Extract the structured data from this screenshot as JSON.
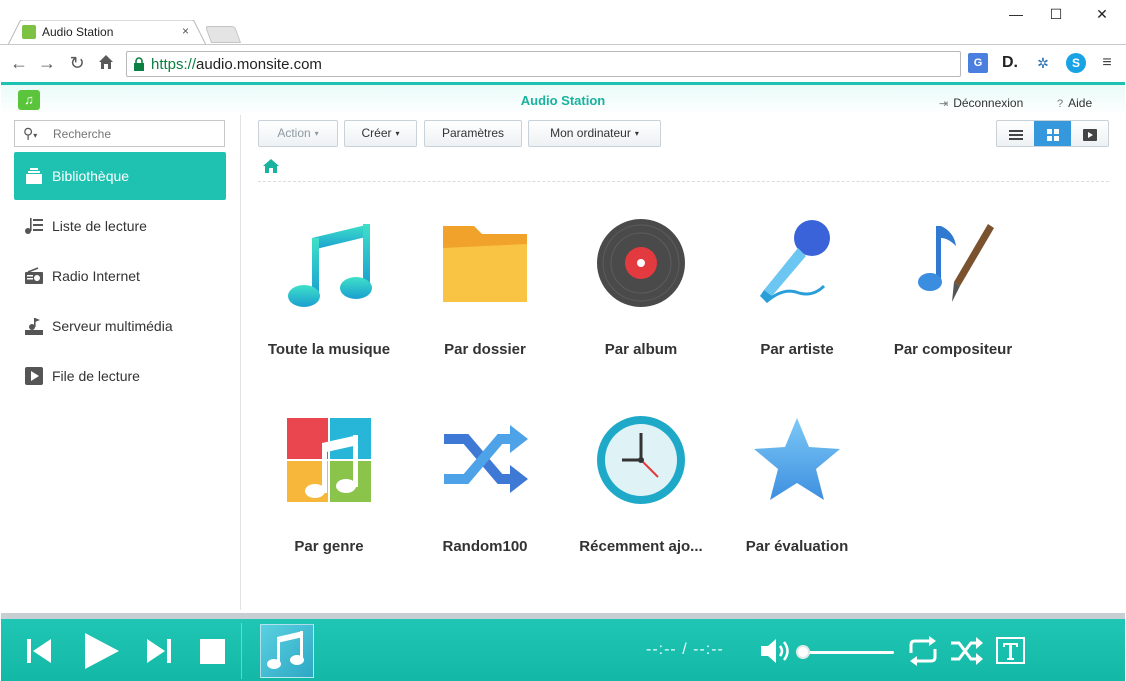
{
  "browser": {
    "tab_title": "Audio Station",
    "tab_close": "×",
    "url_scheme": "https://",
    "url_host": "audio.monsite.com",
    "window_controls": {
      "minimize": "—",
      "maximize": "☐",
      "close": "✕"
    }
  },
  "app": {
    "title": "Audio Station",
    "logout_label": "Déconnexion",
    "help_label": "Aide"
  },
  "sidebar": {
    "search_placeholder": "Recherche",
    "items": [
      {
        "label": "Bibliothèque",
        "icon": "library-icon",
        "active": true
      },
      {
        "label": "Liste de lecture",
        "icon": "playlist-icon"
      },
      {
        "label": "Radio Internet",
        "icon": "radio-icon"
      },
      {
        "label": "Serveur multimédia",
        "icon": "media-server-icon"
      },
      {
        "label": "File de lecture",
        "icon": "play-queue-icon"
      }
    ]
  },
  "toolbar": {
    "action_label": "Action",
    "create_label": "Créer",
    "settings_label": "Paramètres",
    "mycomputer_label": "Mon ordinateur"
  },
  "tiles": [
    {
      "label": "Toute la musique",
      "icon": "music-note-icon"
    },
    {
      "label": "Par dossier",
      "icon": "folder-icon"
    },
    {
      "label": "Par album",
      "icon": "vinyl-icon"
    },
    {
      "label": "Par artiste",
      "icon": "microphone-icon"
    },
    {
      "label": "Par compositeur",
      "icon": "composer-icon"
    },
    {
      "label": "Par genre",
      "icon": "genre-icon"
    },
    {
      "label": "Random100",
      "icon": "shuffle-icon"
    },
    {
      "label": "Récemment ajo...",
      "icon": "clock-icon"
    },
    {
      "label": "Par évaluation",
      "icon": "star-icon"
    }
  ],
  "player": {
    "time_display": "--:-- / --:--",
    "volume": 0,
    "accent": "#1fc2b1"
  },
  "colors": {
    "accent": "#1fc2b1",
    "view_active": "#3598dc",
    "title": "#19b29f"
  }
}
